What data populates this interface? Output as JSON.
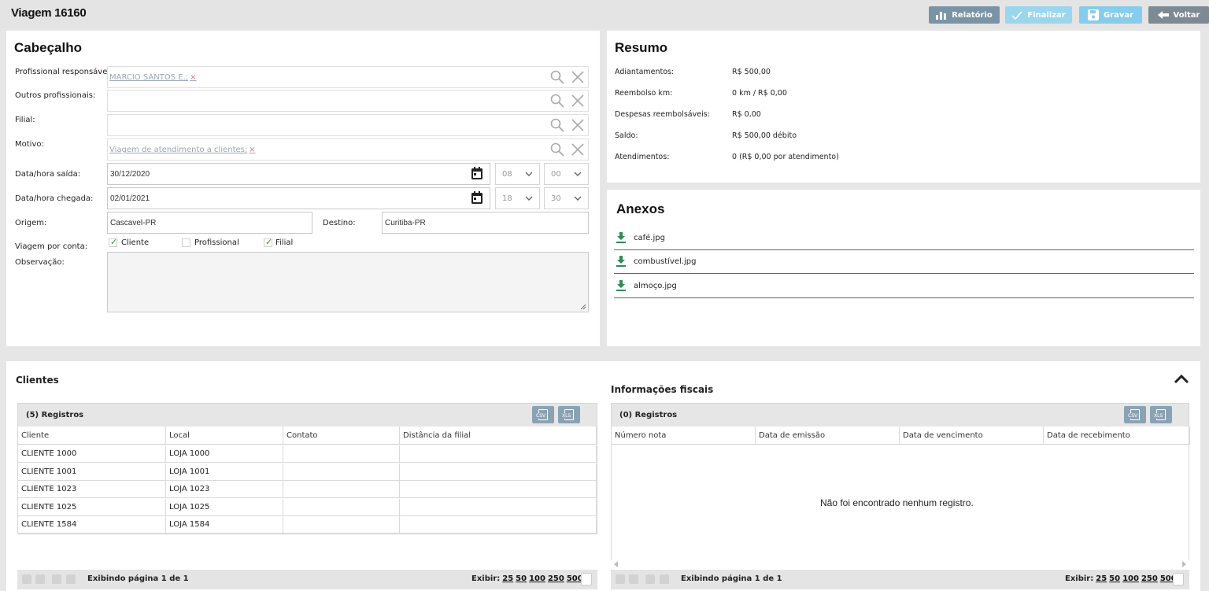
{
  "header": {
    "title": "Viagem 16160",
    "buttons": {
      "relatorio": "Relatório",
      "finalizar": "Finalizar",
      "gravar": "Gravar",
      "voltar": "Voltar"
    }
  },
  "cabecalho": {
    "title": "Cabeçalho",
    "labels": {
      "profissional": "Profissional responsável:",
      "outros": "Outros profissionais:",
      "filial": "Filial:",
      "motivo": "Motivo:",
      "saida": "Data/hora saída:",
      "chegada": "Data/hora chegada:",
      "origem": "Origem:",
      "destino": "Destino:",
      "viagem_por_conta": "Viagem por conta:",
      "observacao": "Observação:"
    },
    "values": {
      "profissional": "MARCIO SANTOS E.;",
      "motivo": "Viagem de atendimento a clientes;",
      "remove_mark": "×",
      "saida_data": "30/12/2020",
      "saida_hora": "08",
      "saida_min": "00",
      "chegada_data": "02/01/2021",
      "chegada_hora": "18",
      "chegada_min": "30",
      "origem": "Cascavel-PR",
      "destino": "Curitiba-PR"
    },
    "checks": {
      "cliente": "Cliente",
      "profissional": "Profissional",
      "filial": "Filial"
    },
    "checked": {
      "cliente": true,
      "profissional": false,
      "filial": true
    }
  },
  "resumo": {
    "title": "Resumo",
    "rows": [
      {
        "label": "Adiantamentos:",
        "value": "R$ 500,00"
      },
      {
        "label": "Reembolso km:",
        "value": "0 km / R$ 0,00"
      },
      {
        "label": "Despesas reembolsáveis:",
        "value": "R$ 0,00"
      },
      {
        "label": "Saldo:",
        "value": "R$ 500,00 débito"
      },
      {
        "label": "Atendimentos:",
        "value": "0 (R$ 0,00 por atendimento)"
      }
    ]
  },
  "anexos": {
    "title": "Anexos",
    "files": [
      "café.jpg",
      "combustível.jpg",
      "almoço.jpg"
    ]
  },
  "clientes": {
    "title": "Clientes",
    "count": "(5) Registros",
    "export": {
      "csv": "CSV",
      "xls": "XLS"
    },
    "columns": [
      "Cliente",
      "Local",
      "Contato",
      "Distância da filial"
    ],
    "rows": [
      [
        "CLIENTE 1000",
        "LOJA 1000",
        "",
        ""
      ],
      [
        "CLIENTE 1001",
        "LOJA 1001",
        "",
        ""
      ],
      [
        "CLIENTE 1023",
        "LOJA 1023",
        "",
        ""
      ],
      [
        "CLIENTE 1025",
        "LOJA 1025",
        "",
        ""
      ],
      [
        "CLIENTE 1584",
        "LOJA 1584",
        "",
        ""
      ]
    ],
    "pager": {
      "text": "Exibindo página 1 de 1",
      "exibir": "Exibir:",
      "sizes": [
        "25",
        "50",
        "100",
        "250",
        "500"
      ]
    }
  },
  "fiscais": {
    "title": "Informações fiscais",
    "count": "(0) Registros",
    "columns": [
      "Número nota",
      "Data de emissão",
      "Data de vencimento",
      "Data de recebimento"
    ],
    "empty": "Não foi encontrado nenhum registro.",
    "pager": {
      "text": "Exibindo página 1 de 1",
      "exibir": "Exibir:",
      "sizes": [
        "25",
        "50",
        "100",
        "250",
        "500"
      ]
    }
  }
}
